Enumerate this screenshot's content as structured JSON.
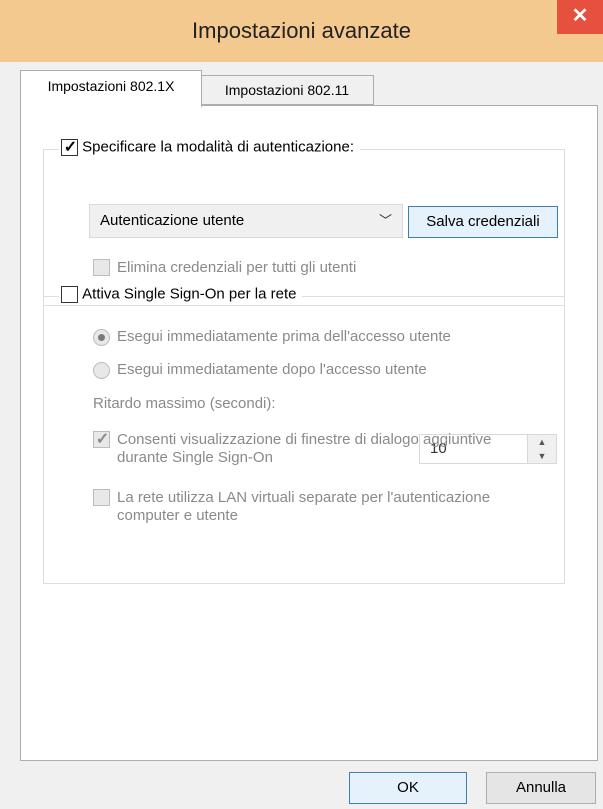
{
  "window": {
    "title": "Impostazioni avanzate",
    "close_glyph": "✕"
  },
  "tabs": [
    {
      "label": "Impostazioni 802.1X",
      "active": true
    },
    {
      "label": "Impostazioni 802.11",
      "active": false
    }
  ],
  "auth_group": {
    "checkbox_label": "Specificare la modalità di autenticazione:",
    "checkbox_checked": true,
    "mode_select_value": "Autenticazione utente",
    "save_credentials_label": "Salva credenziali",
    "delete_credentials_label": "Elimina credenziali per tutti gli utenti",
    "delete_credentials_checked": false
  },
  "sso_group": {
    "checkbox_label": "Attiva Single Sign-On per la rete",
    "checkbox_checked": false,
    "radio_before_label": "Esegui immediatamente prima dell'accesso utente",
    "radio_after_label": "Esegui immediatamente dopo l'accesso utente",
    "selected_radio": "before",
    "max_delay_label": "Ritardo massimo (secondi):",
    "max_delay_value": "10",
    "allow_dialogs_label": "Consenti visualizzazione di finestre di dialogo aggiuntive durante Single Sign-On",
    "allow_dialogs_checked": true,
    "separate_vlan_label": "La rete utilizza LAN virtuali separate per l'autenticazione computer e utente",
    "separate_vlan_checked": false
  },
  "footer": {
    "ok_label": "OK",
    "cancel_label": "Annulla"
  },
  "colors": {
    "titlebar": "#f4c98f",
    "close_button": "#e6513f",
    "ok_border": "#3c7fb1"
  }
}
